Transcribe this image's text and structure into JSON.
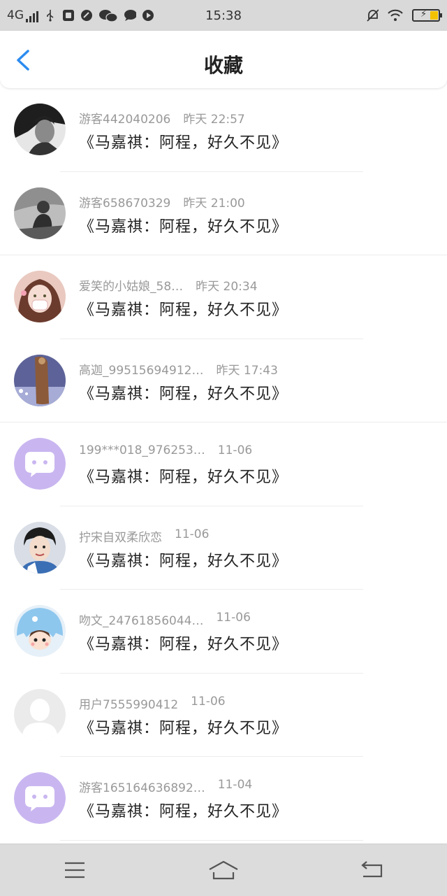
{
  "status_bar": {
    "network": "4G",
    "time": "15:38",
    "icons": [
      "usb-icon",
      "notification-icon",
      "app-icon",
      "wechat-icon",
      "chat-icon",
      "media-icon",
      "mute-icon",
      "wifi-icon",
      "battery-icon"
    ]
  },
  "header": {
    "title": "收藏",
    "back_icon": "chevron-left-icon"
  },
  "items": [
    {
      "user": "游客442040206",
      "time": "昨天 22:57",
      "title": "《马嘉祺：阿程，好久不见》",
      "avatar": "photo-bw-man"
    },
    {
      "user": "游客658670329",
      "time": "昨天 21:00",
      "title": "《马嘉祺：阿程，好久不见》",
      "avatar": "photo-bw-sitting"
    },
    {
      "user": "爱笑的小姑娘_58…",
      "time": "昨天 20:34",
      "title": "《马嘉祺：阿程，好久不见》",
      "avatar": "illustration-girl-pink"
    },
    {
      "user": "高迦_99515694912…",
      "time": "昨天 17:43",
      "title": "《马嘉祺：阿程，好久不见》",
      "avatar": "illustration-blue"
    },
    {
      "user": "199***018_976253…",
      "time": "11-06",
      "title": "《马嘉祺：阿程，好久不见》",
      "avatar": "default-chat-avatar"
    },
    {
      "user": "拧宋自双柔欣恋",
      "time": "11-06",
      "title": "《马嘉祺：阿程，好久不见》",
      "avatar": "photo-boy"
    },
    {
      "user": "吻文_24761856044…",
      "time": "11-06",
      "title": "《马嘉祺：阿程，好久不见》",
      "avatar": "illustration-shark-boy"
    },
    {
      "user": "用户7555990412",
      "time": "11-06",
      "title": "《马嘉祺：阿程，好久不见》",
      "avatar": "default-user-avatar"
    },
    {
      "user": "游客165164636892…",
      "time": "11-04",
      "title": "《马嘉祺：阿程，好久不见》",
      "avatar": "default-chat-avatar"
    }
  ],
  "system_nav": {
    "menu_icon": "menu-icon",
    "home_icon": "home-icon",
    "back_icon": "back-icon"
  },
  "colors": {
    "accent": "#2d8cf0",
    "meta_text": "#999999",
    "default_avatar_bg": "#c9b6f0"
  }
}
